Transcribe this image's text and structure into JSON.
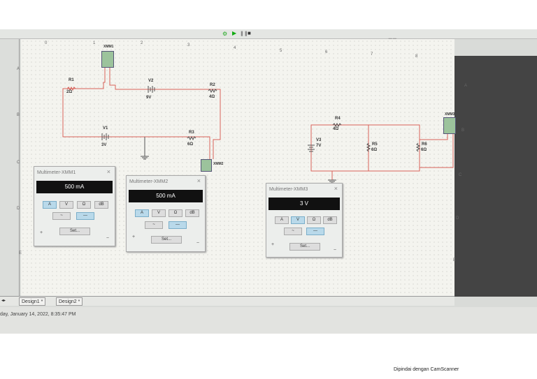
{
  "columns": [
    "0",
    "1",
    "2",
    "3",
    "4",
    "5",
    "6",
    "7",
    "8"
  ],
  "rows_left": [
    "A",
    "B",
    "C",
    "D",
    "E"
  ],
  "rows_right": [
    "A",
    "B",
    "C",
    "D",
    "E"
  ],
  "circuit1": {
    "meter1": "XMM1",
    "meter2": "XMM2",
    "R1": {
      "name": "R1",
      "value": "2Ω"
    },
    "R2": {
      "name": "R2",
      "value": "4Ω"
    },
    "R3": {
      "name": "R3",
      "value": "6Ω"
    },
    "V1": {
      "name": "V1",
      "value": "3V"
    },
    "V2": {
      "name": "V2",
      "value": "9V"
    }
  },
  "circuit2": {
    "meter3": "XMM3",
    "R4": {
      "name": "R4",
      "value": "4Ω"
    },
    "R5": {
      "name": "R5",
      "value": "6Ω"
    },
    "R6": {
      "name": "R6",
      "value": "6Ω"
    },
    "V3": {
      "name": "V3",
      "value": "7V"
    }
  },
  "multimeters": [
    {
      "title": "Multimeter-XMM1",
      "reading": "500 mA",
      "mode": "A"
    },
    {
      "title": "Multimeter-XMM2",
      "reading": "500 mA",
      "mode": "A"
    },
    {
      "title": "Multimeter-XMM3",
      "reading": "3 V",
      "mode": "V"
    }
  ],
  "mm_buttons": {
    "a": "A",
    "v": "V",
    "ohm": "Ω",
    "db": "dB",
    "ac": "~",
    "dc": "—",
    "set": "Set...",
    "plus": "+",
    "minus": "−",
    "close": "×"
  },
  "tabs": [
    {
      "label": "Design1 *"
    },
    {
      "label": "Design2 *"
    }
  ],
  "status": "day, January 14, 2022, 8:35:47 PM",
  "scanner": "Dipindai dengan CamScanner",
  "colors": {
    "wire": "#d9625a",
    "meter": "#9cc39c",
    "display": "#111111",
    "active_button": "#b9d9ea"
  }
}
